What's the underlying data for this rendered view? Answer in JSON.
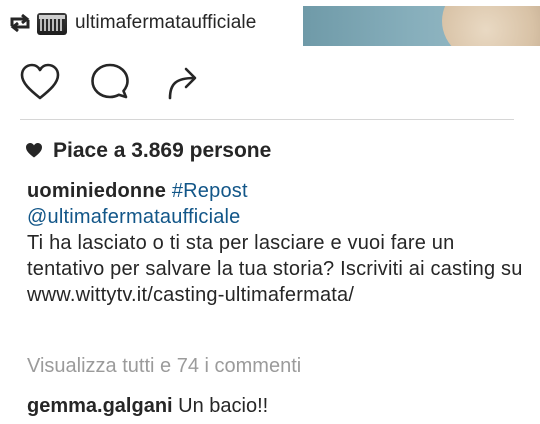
{
  "repost": {
    "username": "ultimafermataufficiale"
  },
  "actions": {
    "like_icon": "heart-outline-icon",
    "comment_icon": "comment-bubble-icon",
    "share_icon": "share-arrow-icon"
  },
  "likes": {
    "text": "Piace a 3.869 persone"
  },
  "caption": {
    "username": "uominiedonne",
    "hashtag": "#Repost",
    "mention": "@ultimafermataufficiale",
    "text": "Ti ha lasciato o ti sta per lasciare e vuoi fare un tentativo per salvare la tua storia? Iscriviti ai casting su www.wittytv.it/casting-ultimafermata/"
  },
  "comments": {
    "view_all": "Visualizza tutti e 74 i commenti",
    "items": [
      {
        "username": "gemma.galgani",
        "text": "Un bacio!!"
      }
    ]
  },
  "colors": {
    "text": "#262626",
    "link": "#125688",
    "muted": "#9b9b9b",
    "divider": "#d6d6d6"
  }
}
